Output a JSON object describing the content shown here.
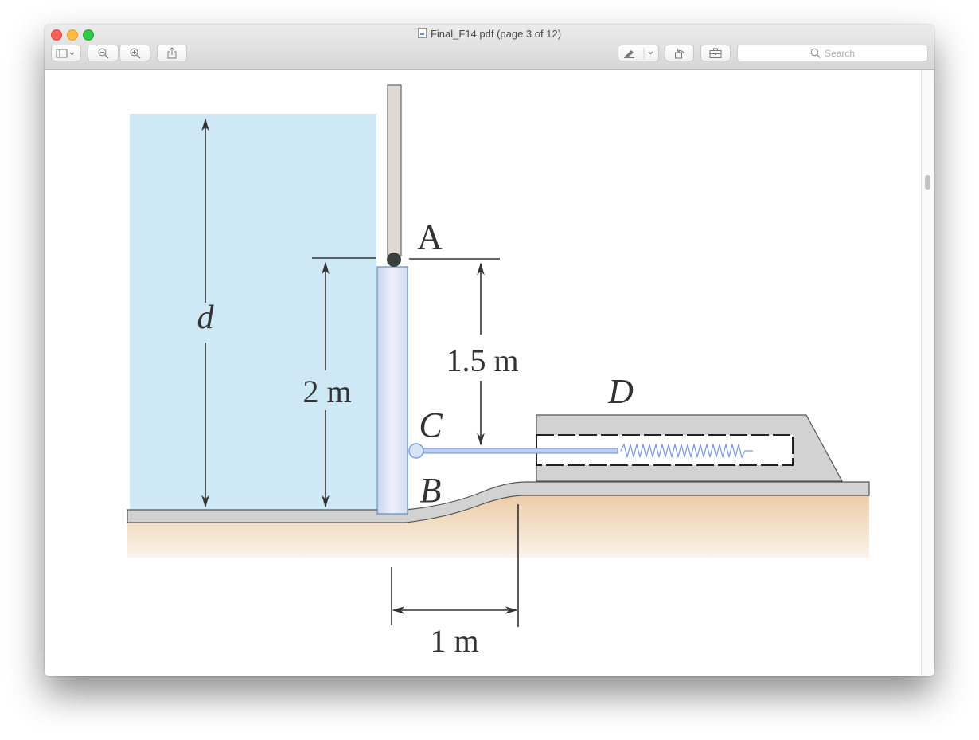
{
  "window": {
    "title": "Final_F14.pdf (page 3 of 12)"
  },
  "toolbar": {
    "sidebar_button": "sidebar-toggle",
    "zoom_out": "zoom-out",
    "zoom_in": "zoom-in",
    "share": "share",
    "markup": "markup",
    "rotate": "rotate",
    "toolbox": "toolbox",
    "search_placeholder": "Search"
  },
  "figure": {
    "labels": {
      "A": "A",
      "B": "B",
      "C": "C",
      "D": "D",
      "d": "d"
    },
    "dimensions": {
      "gate_height": "2 m",
      "hinge_to_rod": "1.5 m",
      "horizontal": "1 m"
    },
    "colors": {
      "water": "#cfe8f5",
      "gate": "#dfe4f4",
      "ground": "#f0d7b8",
      "concrete": "#d2d2d2",
      "rod": "#8fb0dd"
    }
  }
}
